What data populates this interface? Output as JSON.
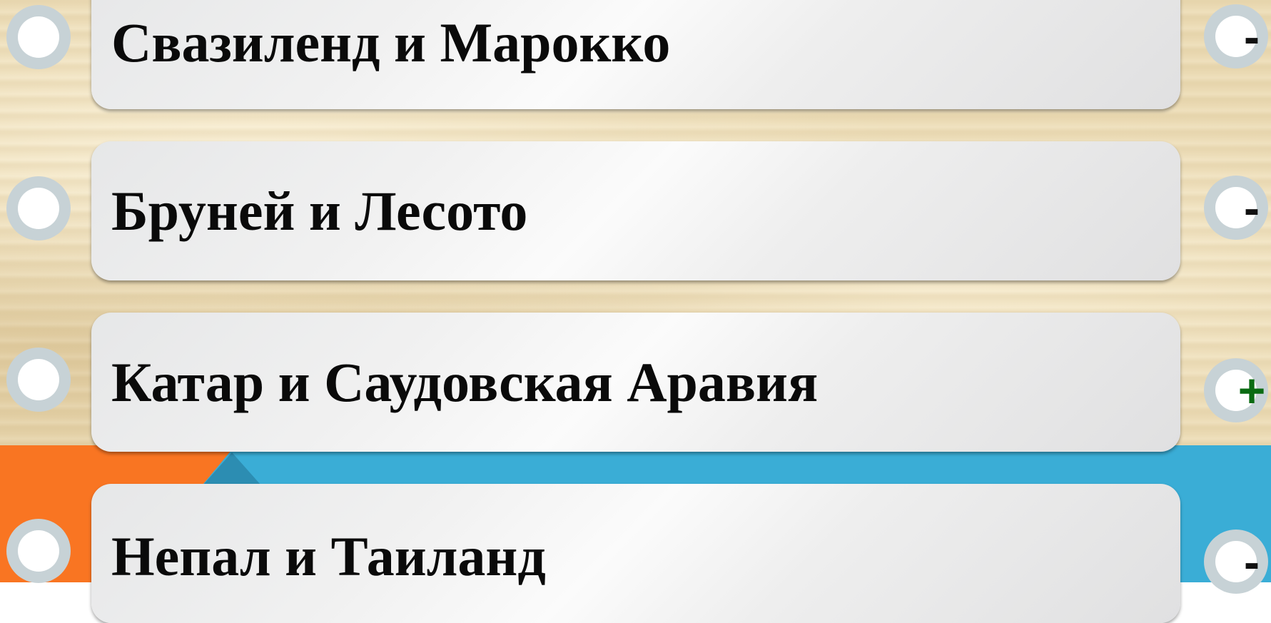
{
  "answers": [
    {
      "label": "Свазиленд и Марокко",
      "mark": "-",
      "mark_icon": "minus-icon",
      "mark_color": "#111111"
    },
    {
      "label": "Бруней и Лесото",
      "mark": "-",
      "mark_icon": "minus-icon",
      "mark_color": "#111111"
    },
    {
      "label": "Катар и Саудовская Аравия",
      "mark": "+",
      "mark_icon": "plus-icon",
      "mark_color": "#0a6b12"
    },
    {
      "label": "Непал и Таиланд",
      "mark": "-",
      "mark_icon": "minus-icon",
      "mark_color": "#111111"
    }
  ],
  "colors": {
    "parchment": "#ecdcb6",
    "bottom_blue": "#3aadd6",
    "bottom_orange": "#f97522",
    "radio_ring": "#c7d2d6",
    "correct_mark": "#0a6b12"
  }
}
